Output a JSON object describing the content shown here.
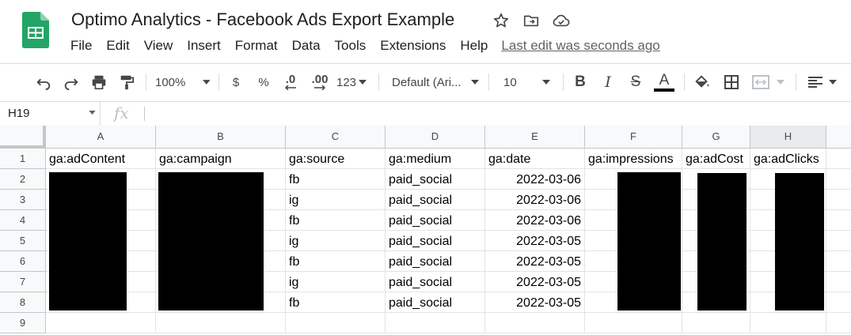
{
  "app": {
    "doc_title": "Optimo Analytics - Facebook Ads Export Example",
    "menu": [
      "File",
      "Edit",
      "View",
      "Insert",
      "Format",
      "Data",
      "Tools",
      "Extensions",
      "Help"
    ],
    "last_edit": "Last edit was seconds ago"
  },
  "toolbar": {
    "zoom": "100%",
    "currency": "$",
    "percent": "%",
    "decrease_decimal": ".0",
    "increase_decimal": ".00",
    "number_format": "123",
    "font": "Default (Ari...",
    "font_size": "10",
    "bold": "B",
    "italic": "I",
    "strike": "S",
    "text_color": "A"
  },
  "formula": {
    "namebox": "H19",
    "fx": "fx",
    "value": ""
  },
  "grid": {
    "columns": [
      "A",
      "B",
      "C",
      "D",
      "E",
      "F",
      "G",
      "H"
    ],
    "rows": [
      "1",
      "2",
      "3",
      "4",
      "5",
      "6",
      "7",
      "8",
      "9"
    ],
    "headers": [
      "ga:adContent",
      "ga:campaign",
      "ga:source",
      "ga:medium",
      "ga:date",
      "ga:impressions",
      "ga:adCost",
      "ga:adClicks"
    ],
    "data": [
      {
        "source": "fb",
        "medium": "paid_social",
        "date": "2022-03-06"
      },
      {
        "source": "ig",
        "medium": "paid_social",
        "date": "2022-03-06"
      },
      {
        "source": "fb",
        "medium": "paid_social",
        "date": "2022-03-06"
      },
      {
        "source": "ig",
        "medium": "paid_social",
        "date": "2022-03-05"
      },
      {
        "source": "fb",
        "medium": "paid_social",
        "date": "2022-03-05"
      },
      {
        "source": "ig",
        "medium": "paid_social",
        "date": "2022-03-05"
      },
      {
        "source": "fb",
        "medium": "paid_social",
        "date": "2022-03-05"
      }
    ]
  },
  "colors": {
    "sheets_green": "#23a566",
    "redaction": "#000000"
  }
}
